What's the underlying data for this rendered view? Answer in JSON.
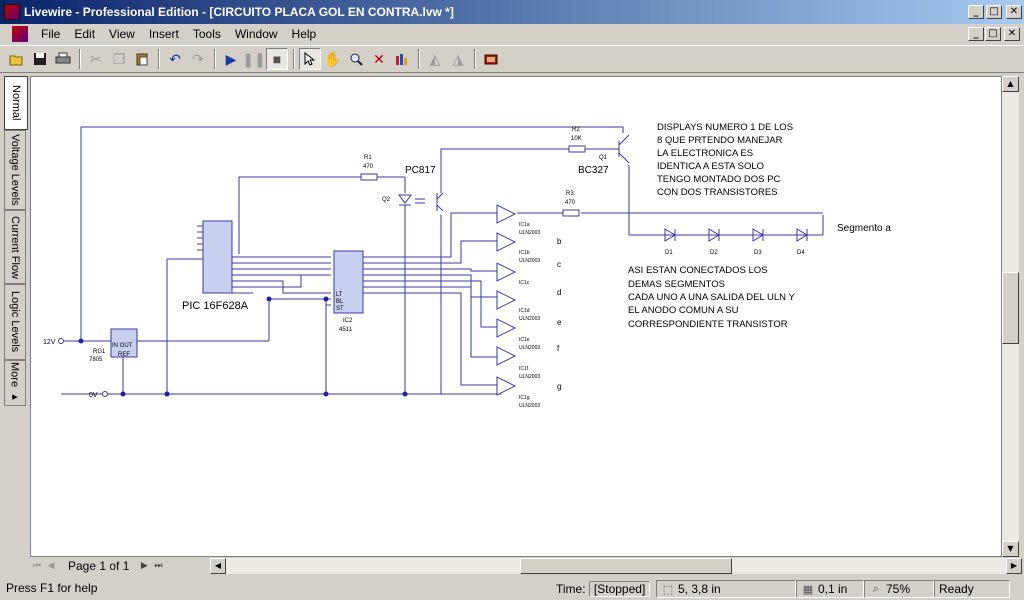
{
  "window": {
    "title": "Livewire - Professional Edition - [CIRCUITO PLACA GOL EN CONTRA.lvw *]",
    "controls": {
      "minimize": "_",
      "maximize": "□",
      "close": "✕"
    }
  },
  "menu": [
    "File",
    "Edit",
    "View",
    "Insert",
    "Tools",
    "Window",
    "Help"
  ],
  "toolbar": {
    "icons": [
      "open-icon",
      "save-icon",
      "print-icon",
      "cut-icon",
      "copy-icon",
      "paste-icon",
      "undo-icon",
      "redo-icon",
      "play-icon",
      "pause-icon",
      "stop-icon",
      "select-pointer-icon",
      "pan-hand-icon",
      "zoom-icon",
      "delete-icon",
      "parts-bin-icon",
      "flip-horizontal-icon",
      "flip-vertical-icon",
      "gallery-icon"
    ]
  },
  "side_tabs": [
    "Normal",
    "Voltage Levels",
    "Current Flow",
    "Logic Levels",
    "More ▸"
  ],
  "schematic": {
    "annotation_1": [
      "DISPLAYS NUMERO 1 DE LOS",
      "8 QUE PRTENDO MANEJAR",
      "LA ELECTRONICA ES",
      "IDENTICA A ESTA SOLO",
      "TENGO MONTADO DOS PC",
      "CON DOS TRANSISTORES"
    ],
    "annotation_2": [
      "ASI ESTAN CONECTADOS LOS",
      "DEMAS SEGMENTOS",
      "CADA UNO A UNA SALIDA DEL ULN Y",
      "EL ANODO COMUN A SU",
      "CORRESPONDIENTE TRANSISTOR"
    ],
    "pic_label": "PIC 16F628A",
    "opto_label": "PC817",
    "opto_ref": "Q2",
    "transistor_label": "BC327",
    "transistor_ref": "Q1",
    "r1": {
      "ref": "R1",
      "value": "470"
    },
    "r2": {
      "ref": "R2",
      "value": "10K"
    },
    "r3": {
      "ref": "R3",
      "value": "470"
    },
    "regulator": {
      "ref": "RG1",
      "part": "7805",
      "pins": "IN OUT",
      "ref_pin": "REF"
    },
    "decoder": {
      "ref": "IC2",
      "part": "4511",
      "pins": [
        "LT",
        "BL",
        "ST"
      ]
    },
    "supply_12v": "12V",
    "supply_0v": "0V",
    "segment_label": "Segmento a",
    "diodes": [
      "D1",
      "D2",
      "D3",
      "D4"
    ],
    "segment_letters": [
      "b",
      "c",
      "d",
      "e",
      "f",
      "g"
    ],
    "driver_chip": "ULN2003",
    "gates": [
      "IC1a",
      "IC1b",
      "IC1c",
      "IC1d",
      "IC1e",
      "IC1f",
      "IC1g"
    ]
  },
  "bottom": {
    "page_label": "Page 1 of 1"
  },
  "status": {
    "help": "Press F1 for help",
    "time_label": "Time:",
    "time_value": "[Stopped]",
    "coords": "5, 3,8 in",
    "grid": "0,1 in",
    "zoom": "75%",
    "state": "Ready"
  }
}
